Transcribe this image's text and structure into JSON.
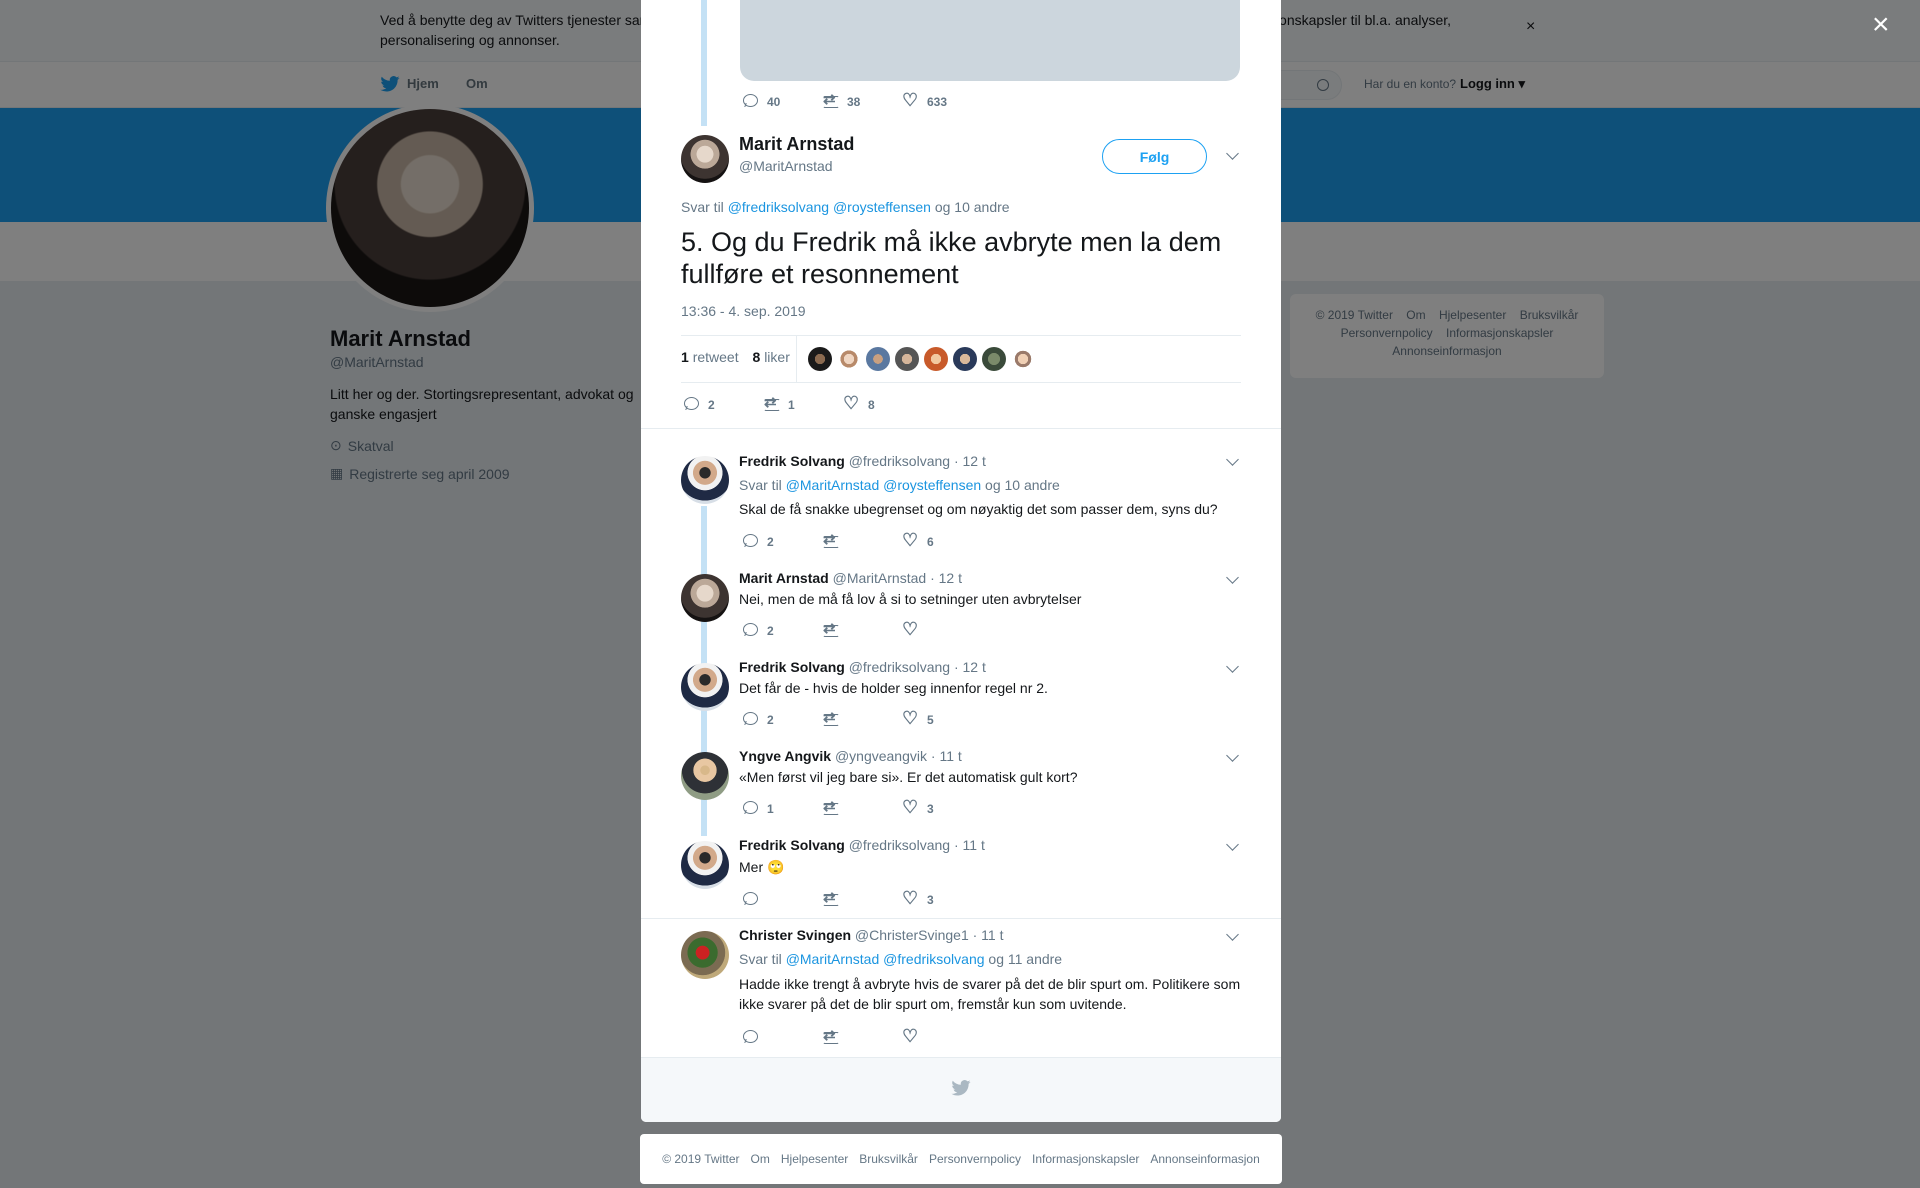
{
  "cookie": {
    "text": "Ved å benytte deg av Twitters tjenester samtykker du i at vi benytter informasjonskapsler. Vi og våre partnere opererer globalt og bruker informasjonskapsler til bl.a. analyser, personalisering og annonser.",
    "close": "×"
  },
  "nav": {
    "home": "Hjem",
    "about": "Om",
    "have_account": "Har du en konto?",
    "login": "Logg inn"
  },
  "profile": {
    "name": "Marit Arnstad",
    "handle": "@MaritArnstad",
    "bio": "Litt her og der. Stortingsrepresentant, advokat og ganske engasjert",
    "location": "Skatval",
    "joined": "Registrerte seg april 2009"
  },
  "right_footer": [
    "© 2019 Twitter",
    "Om",
    "Hjelpesenter",
    "Bruksvilkår",
    "Personvernpolicy",
    "Informasjonskapsler",
    "Annonseinformasjon"
  ],
  "overlay_close": "×",
  "prev_tweet": {
    "replies": "40",
    "retweets": "38",
    "likes": "633"
  },
  "main_tweet": {
    "name": "Marit Arnstad",
    "handle": "@MaritArnstad",
    "follow": "Følg",
    "reply_prefix": "Svar til",
    "reply_to": "@fredriksolvang @roysteffensen",
    "reply_suffix": "og 10 andre",
    "text": "5. Og du Fredrik må ikke avbryte men la dem fullføre et resonnement",
    "timestamp": "13:36 - 4. sep. 2019",
    "retweet_count": "1",
    "retweet_label": "retweet",
    "like_count": "8",
    "like_label": "liker",
    "replies": "2",
    "retweets": "1",
    "likes": "8"
  },
  "replies": [
    {
      "name": "Fredrik Solvang",
      "handle": "@fredriksolvang",
      "time": "· 12 t",
      "reply_prefix": "Svar til",
      "reply_to": "@MaritArnstad @roysteffensen",
      "reply_suffix": "og 10 andre",
      "text": "Skal de få snakke ubegrenset og om nøyaktig det som passer dem, syns du?",
      "replies": "2",
      "retweets": "",
      "likes": "6"
    },
    {
      "name": "Marit Arnstad",
      "handle": "@MaritArnstad",
      "time": "· 12 t",
      "text": "Nei, men de må få lov å si to setninger uten avbrytelser",
      "replies": "2",
      "retweets": "",
      "likes": ""
    },
    {
      "name": "Fredrik Solvang",
      "handle": "@fredriksolvang",
      "time": "· 12 t",
      "text": "Det får de - hvis de holder seg innenfor regel nr 2.",
      "replies": "2",
      "retweets": "",
      "likes": "5"
    },
    {
      "name": "Yngve Angvik",
      "handle": "@yngveangvik",
      "time": "· 11 t",
      "text": "«Men først vil jeg bare si». Er det automatisk gult kort?",
      "replies": "1",
      "retweets": "",
      "likes": "3"
    },
    {
      "name": "Fredrik Solvang",
      "handle": "@fredriksolvang",
      "time": "· 11 t",
      "text": "Mer 🙄",
      "replies": "",
      "retweets": "",
      "likes": "3"
    },
    {
      "name": "Christer Svingen",
      "handle": "@ChristerSvinge1",
      "time": "· 11 t",
      "reply_prefix": "Svar til",
      "reply_to": "@MaritArnstad @fredriksolvang",
      "reply_suffix": "og 11 andre",
      "text": "Hadde ikke trengt å avbryte hvis de svarer på det de blir spurt om. Politikere som ikke svarer på det de blir spurt om, fremstår kun som uvitende.",
      "replies": "",
      "retweets": "",
      "likes": ""
    }
  ],
  "modal_footer": [
    "© 2019 Twitter",
    "Om",
    "Hjelpesenter",
    "Bruksvilkår",
    "Personvernpolicy",
    "Informasjonskapsler",
    "Annonseinformasjon"
  ],
  "colors": {
    "accent": "#1da1f2",
    "link": "#1b95e0",
    "muted": "#657786",
    "thread": "#c4e1f5"
  }
}
